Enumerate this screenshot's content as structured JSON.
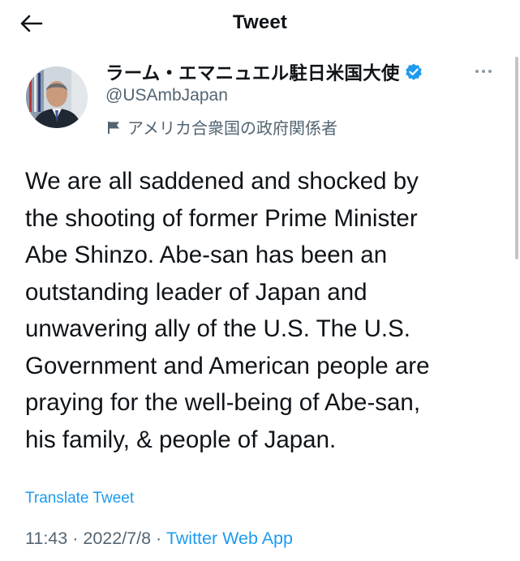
{
  "header": {
    "title": "Tweet",
    "back_icon": "arrow-left-icon"
  },
  "author": {
    "display_name": "ラーム・エマニュエル駐日米国大使",
    "handle": "@USAmbJapan",
    "verified": true,
    "verified_icon": "verified-badge-icon",
    "label_icon": "government-flag-icon",
    "label": "アメリカ合衆国の政府関係者",
    "more_icon": "more-horizontal-icon"
  },
  "tweet": {
    "text": "We are all saddened and shocked by\nthe shooting of former Prime Minister\nAbe Shinzo.  Abe-san has been an\noutstanding leader of Japan and\nunwavering ally of the U.S. The U.S.\nGovernment and American people are\npraying for the well-being of Abe-san,\nhis family, & people of Japan.",
    "translate_label": "Translate Tweet",
    "time": "11:43",
    "separator": "·",
    "date": "2022/7/8",
    "source": "Twitter Web App"
  },
  "colors": {
    "accent": "#1d9bf0",
    "text_primary": "#0f1419",
    "text_secondary": "#536471",
    "background": "#ffffff"
  }
}
